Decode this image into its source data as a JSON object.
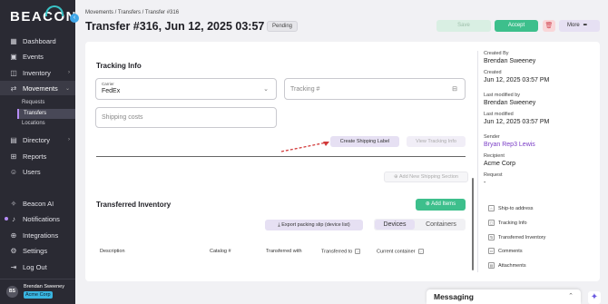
{
  "brand": {
    "logo_text": "BEACON",
    "collapse_icon": "chevron-left-icon"
  },
  "sidebar": {
    "items": [
      {
        "label": "Dashboard",
        "icon": "dashboard-icon"
      },
      {
        "label": "Events",
        "icon": "calendar-icon"
      },
      {
        "label": "Inventory",
        "icon": "inventory-icon",
        "has_submenu": true
      },
      {
        "label": "Movements",
        "icon": "movements-icon",
        "has_submenu": true,
        "active": true
      },
      {
        "label": "Directory",
        "icon": "directory-icon",
        "has_submenu": true
      },
      {
        "label": "Reports",
        "icon": "reports-icon"
      },
      {
        "label": "Users",
        "icon": "users-icon"
      },
      {
        "label": "Beacon AI",
        "icon": "ai-icon"
      },
      {
        "label": "Notifications",
        "icon": "bell-icon"
      },
      {
        "label": "Integrations",
        "icon": "integrations-icon"
      },
      {
        "label": "Settings",
        "icon": "gear-icon"
      },
      {
        "label": "Log Out",
        "icon": "logout-icon"
      }
    ],
    "subitems": [
      {
        "label": "Requests"
      },
      {
        "label": "Transfers",
        "active": true
      },
      {
        "label": "Locations"
      }
    ],
    "user": {
      "initials": "BS",
      "name": "Brendan Sweeney",
      "org": "Acme Corp"
    }
  },
  "header": {
    "breadcrumb": "Movements / Transfers / Transfer #316",
    "title": "Transfer #316, Jun 12, 2025 03:57 PM",
    "status": "Pending",
    "save_label": "Save",
    "accept_label": "Accept",
    "more_label": "More"
  },
  "tracking": {
    "title": "Tracking Info",
    "carrier_label": "Carrier",
    "carrier_value": "FedEx",
    "tracking_placeholder": "Tracking #",
    "shipping_costs_placeholder": "Shipping costs",
    "create_label_button": "Create Shipping Label",
    "view_tracking_button": "View Tracking Info",
    "add_section_button": "Add New Shipping Section"
  },
  "inventory": {
    "title": "Transferred Inventory",
    "add_items_button": "Add Items",
    "export_button": "Export packing slip (device list)",
    "toggle": {
      "devices": "Devices",
      "containers": "Containers",
      "selected": "Devices"
    },
    "columns": [
      "Description",
      "Catalog #",
      "Transferred with",
      "Transferred to",
      "Current container"
    ]
  },
  "details": {
    "created_by_label": "Created By",
    "created_by": "Brendan Sweeney",
    "created_label": "Created",
    "created": "Jun 12, 2025 03:57 PM",
    "last_modified_by_label": "Last modified by",
    "last_modified_by": "Brendan Sweeney",
    "last_modified_label": "Last modified",
    "last_modified": "Jun 12, 2025 03:57 PM",
    "sender_label": "Sender",
    "sender": "Bryan Rep3 Lewis",
    "recipient_label": "Recipient",
    "recipient": "Acme Corp",
    "request_label": "Request",
    "request": "-",
    "links": [
      "Ship-to address",
      "Tracking Info",
      "Transferred Inventory",
      "Comments",
      "Attachments"
    ]
  },
  "messaging": {
    "label": "Messaging"
  },
  "colors": {
    "accent_green": "#3dbf8c",
    "accent_purple": "#b58cf6",
    "sidebar_bg": "#2a2a33",
    "link_purple": "#7a3cc6"
  }
}
